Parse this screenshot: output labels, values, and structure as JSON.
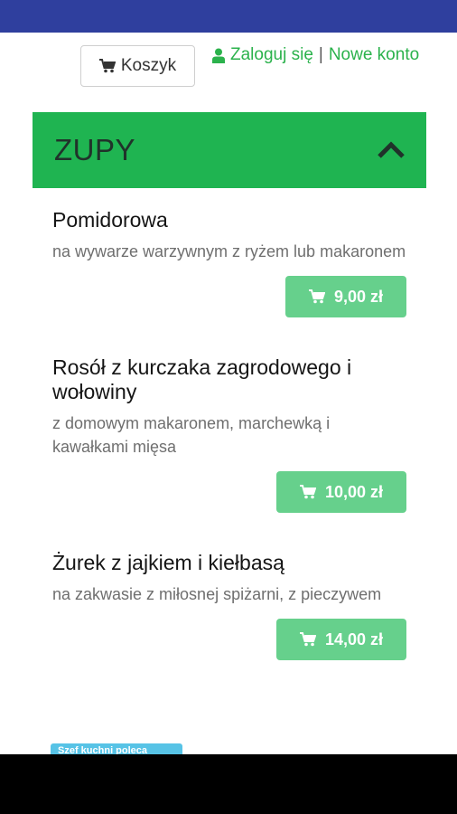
{
  "header": {
    "cart_label": "Koszyk",
    "login_label": "Zaloguj się",
    "separator": "|",
    "register_label": "Nowe konto"
  },
  "section": {
    "title": "ZUPY",
    "collapse_icon": "chevron-up-icon"
  },
  "items": [
    {
      "name": "Pomidorowa",
      "description": "na wywarze warzywnym z ryżem lub makaronem",
      "price": "9,00 zł"
    },
    {
      "name": "Rosół z kurczaka zagrodowego i wołowiny",
      "description": "z domowym makaronem, marchewką i kawałkami mięsa",
      "price": "10,00 zł"
    },
    {
      "name": "Żurek z jajkiem i kiełbasą",
      "description": "na zakwasie z miłosnej spiżarni, z pieczywem",
      "price": "14,00 zł"
    }
  ],
  "footer_tag": "Szef kuchni poleca",
  "colors": {
    "status_bar": "#2f3f9e",
    "accent_green": "#1fb451",
    "link_green": "#2bb24c",
    "price_button": "#66d08c",
    "tag": "#57c3e6"
  }
}
